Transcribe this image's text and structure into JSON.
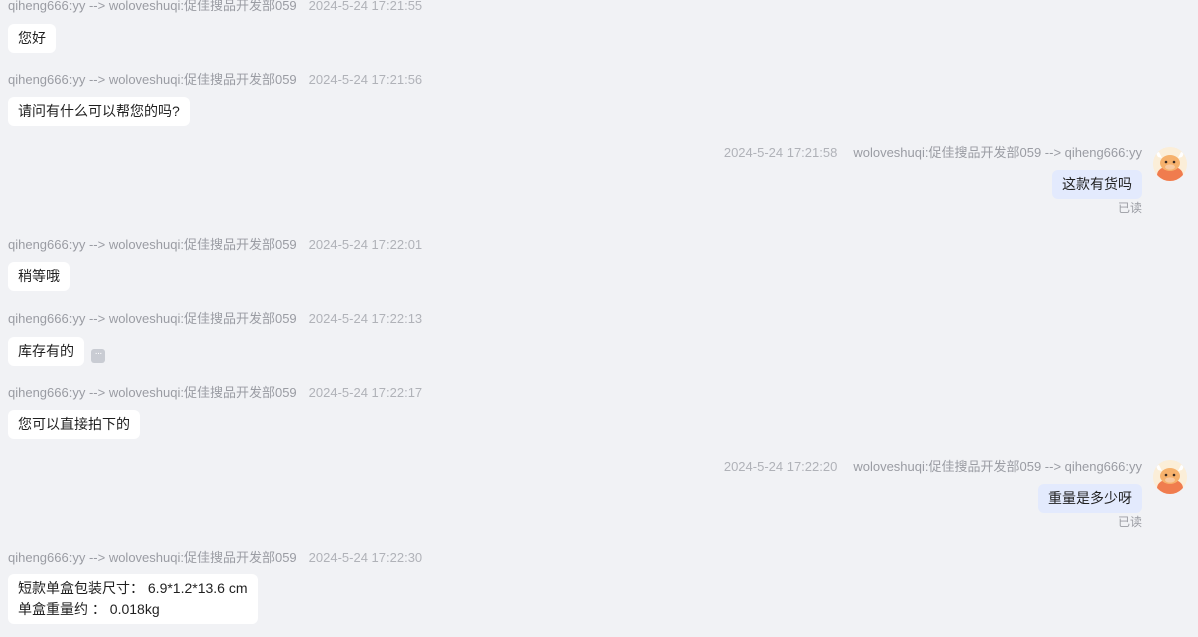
{
  "messages": [
    {
      "sender": "qiheng666:yy --> woloveshuqi:促佳搜品开发部059",
      "time": "2024-5-24 17:21:55",
      "text": "您好"
    },
    {
      "sender": "qiheng666:yy --> woloveshuqi:促佳搜品开发部059",
      "time": "2024-5-24 17:21:56",
      "text": "请问有什么可以帮您的吗?"
    },
    {
      "sender": "woloveshuqi:促佳搜品开发部059 --> qiheng666:yy",
      "time": "2024-5-24 17:21:58",
      "text": "这款有货吗",
      "status": "已读"
    },
    {
      "sender": "qiheng666:yy --> woloveshuqi:促佳搜品开发部059",
      "time": "2024-5-24 17:22:01",
      "text": "稍等哦"
    },
    {
      "sender": "qiheng666:yy --> woloveshuqi:促佳搜品开发部059",
      "time": "2024-5-24 17:22:13",
      "text": "库存有的"
    },
    {
      "sender": "qiheng666:yy --> woloveshuqi:促佳搜品开发部059",
      "time": "2024-5-24 17:22:17",
      "text": "您可以直接拍下的"
    },
    {
      "sender": "woloveshuqi:促佳搜品开发部059 --> qiheng666:yy",
      "time": "2024-5-24 17:22:20",
      "text": "重量是多少呀",
      "status": "已读"
    },
    {
      "sender": "qiheng666:yy --> woloveshuqi:促佳搜品开发部059",
      "time": "2024-5-24 17:22:30",
      "lines": [
        "短款单盒包装尺寸： 6.9*1.2*13.6 cm",
        "单盒重量约 ： 0.018kg"
      ]
    }
  ],
  "icons": {
    "avatar": "cow-avatar-icon",
    "more": "more-options-icon"
  },
  "colors": {
    "background": "#f1f2f5",
    "incoming_bubble": "#ffffff",
    "outgoing_bubble": "#e3eafd",
    "meta_text": "#9a9ca3"
  }
}
